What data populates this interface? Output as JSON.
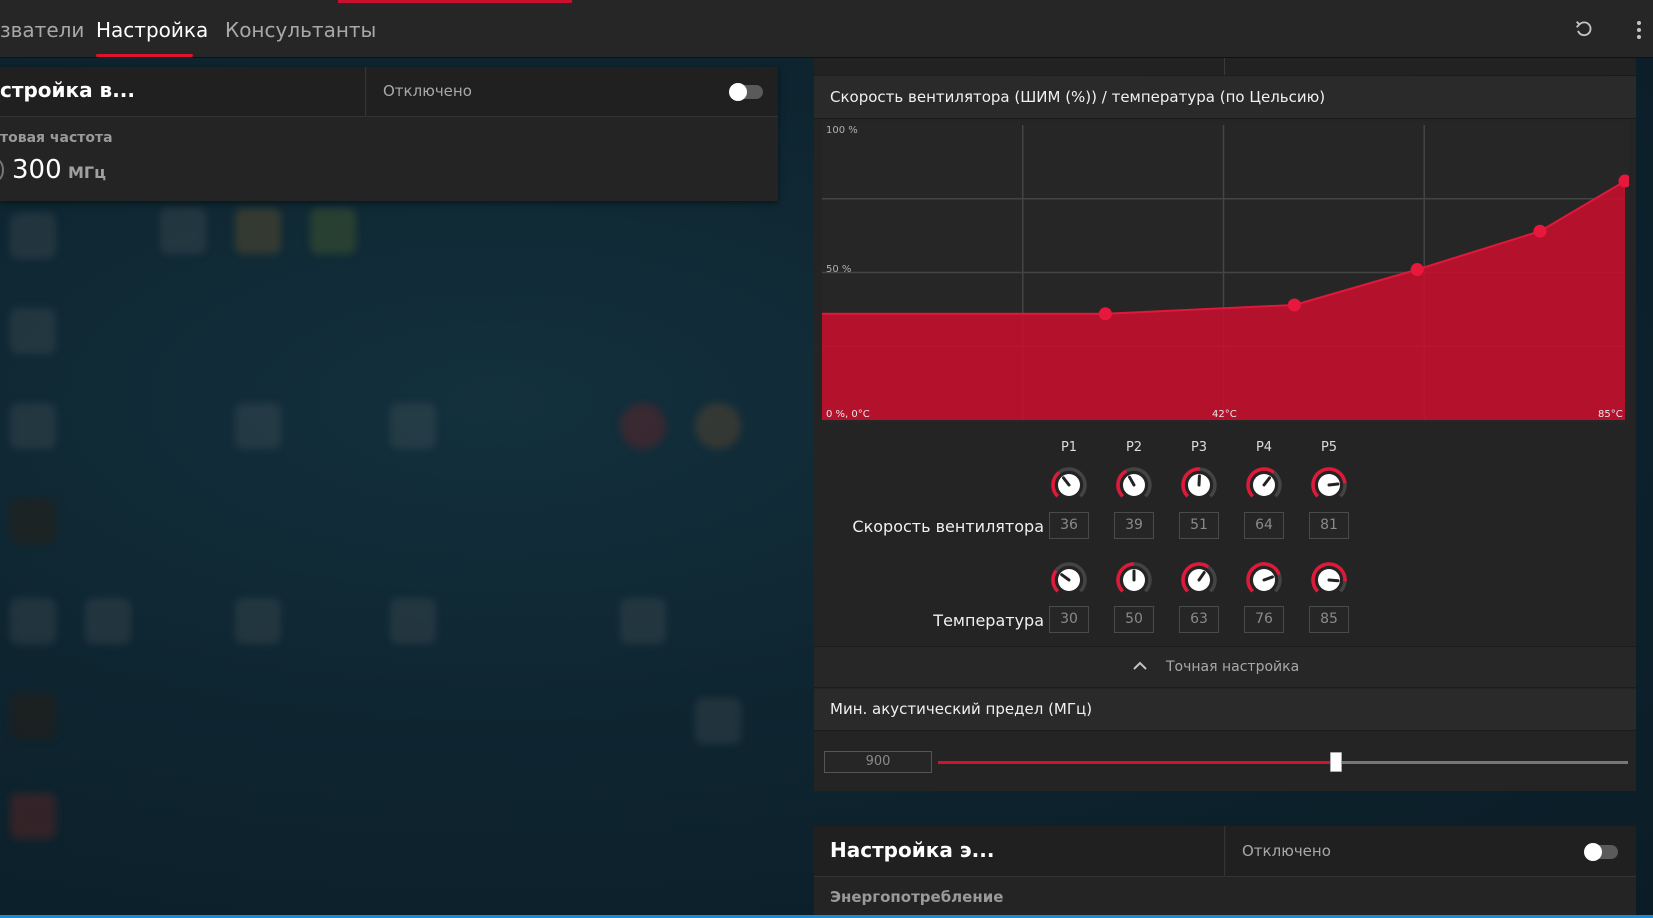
{
  "nav": {
    "tabs": [
      {
        "label": "зватели"
      },
      {
        "label": "Настройка"
      },
      {
        "label": "Консультанты"
      }
    ]
  },
  "icons": {
    "reset": "reset-icon",
    "more": "more-vertical-icon"
  },
  "left_panel": {
    "title": "стройка в...",
    "status": "Отключено",
    "freq_label": "товая частота",
    "freq_value": "300",
    "freq_unit": "МГц"
  },
  "fan_card": {
    "title": "Скорость вентилятора (ШИМ (%)) / температура (по Цельсию)",
    "points": [
      "P1",
      "P2",
      "P3",
      "P4",
      "P5"
    ],
    "fan_speed_label": "Скорость вентилятора",
    "temperature_label": "Температура",
    "fan_speeds": [
      "36",
      "39",
      "51",
      "64",
      "81"
    ],
    "temperatures": [
      "30",
      "50",
      "63",
      "76",
      "85"
    ],
    "fine_tune_label": "Точная настройка",
    "acoustic_label": "Мин. акустический предел (МГц)",
    "acoustic_value": "900",
    "acoustic_fraction": 0.577,
    "accent": "#c8102e"
  },
  "chart_data": {
    "type": "area",
    "x": [
      0,
      30,
      50,
      63,
      76,
      85
    ],
    "series": [
      {
        "values": [
          36,
          36,
          39,
          51,
          64,
          81
        ]
      }
    ],
    "y_tick_labels": [
      "100 %",
      "50 %",
      "0 %, 0°C"
    ],
    "x_tick_labels": [
      "42°C",
      "85°C"
    ],
    "xlim": [
      0,
      85
    ],
    "ylim": [
      0,
      100
    ],
    "grid": true
  },
  "bottom_card": {
    "title": "Настройка э...",
    "status": "Отключено",
    "sub": "Энергопотребление"
  }
}
